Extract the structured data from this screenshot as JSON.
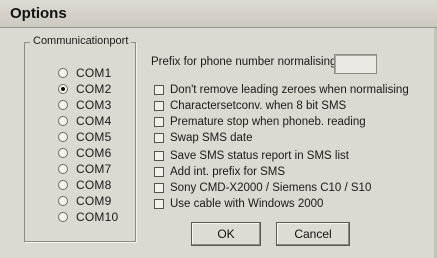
{
  "window": {
    "title": "Options"
  },
  "communication_port": {
    "label": "Communicationport",
    "selected": "COM2",
    "ports": [
      "COM1",
      "COM2",
      "COM3",
      "COM4",
      "COM5",
      "COM6",
      "COM7",
      "COM8",
      "COM9",
      "COM10"
    ]
  },
  "prefix": {
    "label": "Prefix for phone number normalising",
    "value": ""
  },
  "options": [
    {
      "label": "Don't remove leading zeroes when normalising",
      "checked": false
    },
    {
      "label": "Charactersetconv. when 8 bit SMS",
      "checked": false
    },
    {
      "label": "Premature stop when phoneb. reading",
      "checked": false
    },
    {
      "label": "Swap SMS date",
      "checked": false
    },
    {
      "label": "Save SMS status report in SMS list",
      "checked": false
    },
    {
      "label": "Add int. prefix for SMS",
      "checked": false
    },
    {
      "label": "Sony CMD-X2000 / Siemens C10 / S10",
      "checked": false
    },
    {
      "label": "Use cable with Windows 2000",
      "checked": false
    }
  ],
  "buttons": {
    "ok": "OK",
    "cancel": "Cancel"
  }
}
